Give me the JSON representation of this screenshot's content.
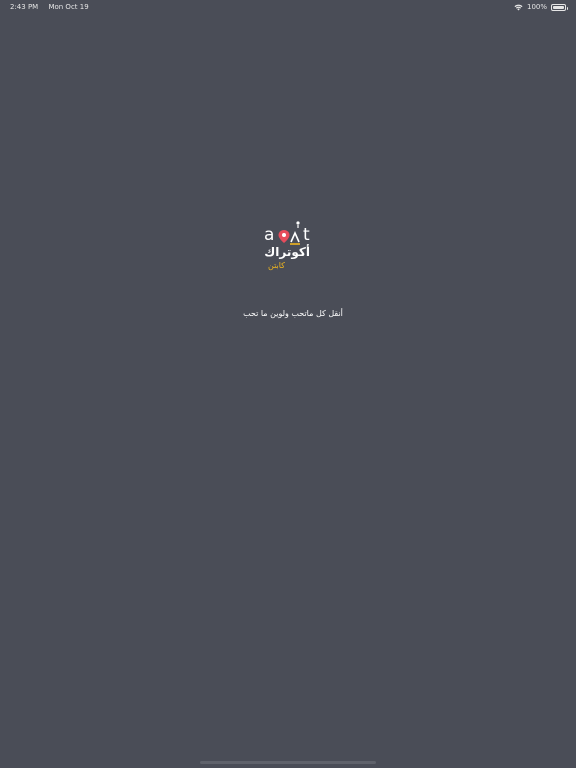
{
  "status_bar": {
    "time": "2:43 PM",
    "date": "Mon Oct 19",
    "battery_text": "100%",
    "battery_level": 1.0,
    "wifi_icon": "wifi-icon"
  },
  "logo": {
    "latin_text": "aqit",
    "arabic_name": "أكوتراك",
    "arabic_sub": "كابتن",
    "pin_color": "#e74c5c",
    "accent_color": "#f0b61e"
  },
  "tagline": "أنقل كل ماتحب ولوين ما تحب",
  "colors": {
    "background": "#4a4d57"
  }
}
